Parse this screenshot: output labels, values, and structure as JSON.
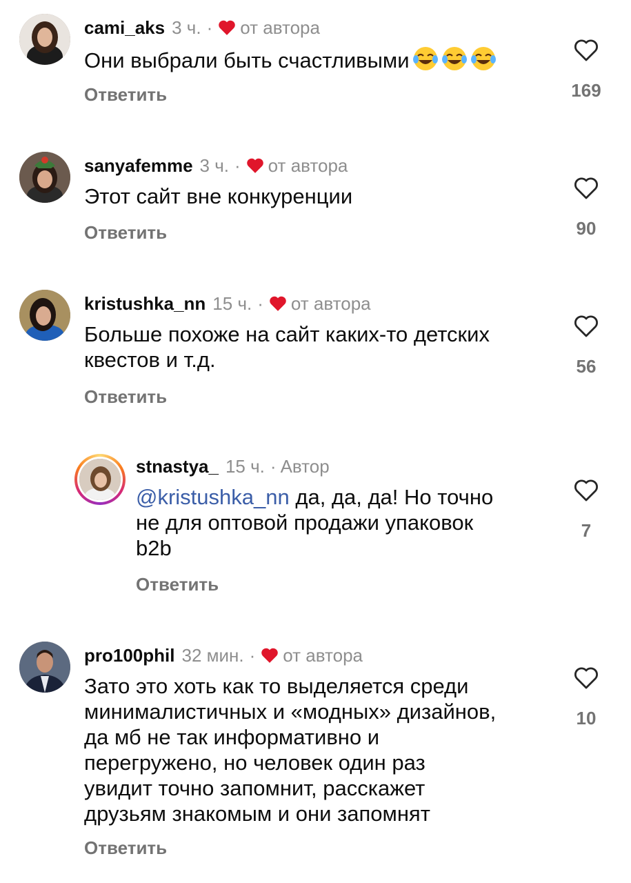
{
  "colors": {
    "heart": "#e0162b",
    "muted": "#8e8e8e",
    "mention": "#3b5ea8"
  },
  "comments": [
    {
      "username": "cami_aks",
      "time": "3 ч.",
      "dot": "·",
      "badge": "от автора",
      "text": "Они выбрали быть счастливыми",
      "emoji": "face-with-tears-of-joy x3",
      "reply": "Ответить",
      "likes": "169"
    },
    {
      "username": "sanyafemme",
      "time": "3 ч.",
      "dot": "·",
      "badge": "от автора",
      "text": "Этот сайт вне конкуренции",
      "reply": "Ответить",
      "likes": "90"
    },
    {
      "username": "kristushka_nn",
      "time": "15 ч.",
      "dot": "·",
      "badge": "от автора",
      "text": "Больше похоже на сайт каких-то детских\nквестов и т.д.",
      "reply": "Ответить",
      "likes": "56"
    },
    {
      "username": "stnastya_",
      "time": "15 ч.",
      "dot": "·",
      "badge": "Автор",
      "mention": "@kristushka_nn",
      "text": " да, да, да! Но точно\nне для оптовой продажи упаковок\nb2b",
      "reply": "Ответить",
      "likes": "7"
    },
    {
      "username": "pro100phil",
      "time": "32 мин.",
      "dot": "·",
      "badge": "от автора",
      "text": "Зато это хоть как то выделяется среди\nминималистичных и «модных» дизайнов,\nда мб не так информативно и\nперегружено, но человек один раз\nувидит точно запомнит, расскажет\nдрузьям знакомым и они запомнят",
      "reply": "Ответить",
      "likes": "10"
    }
  ]
}
